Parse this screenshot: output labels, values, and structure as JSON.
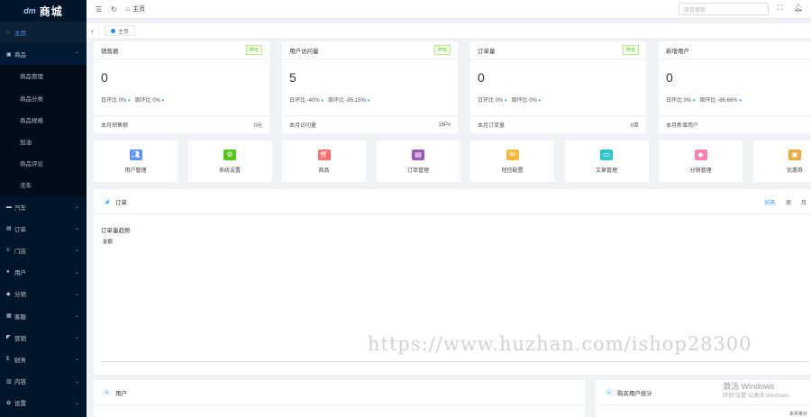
{
  "brand": {
    "mark": "dm",
    "name": "商城"
  },
  "sidebar": {
    "home": {
      "icon": "⌂",
      "label": "主页"
    },
    "goods_group": {
      "icon": "▣",
      "label": "商品"
    },
    "goods_sub": [
      "商品管理",
      "商品分类",
      "商品规格",
      "加油",
      "商品评论",
      "洗车"
    ],
    "groups": [
      {
        "icon": "▬",
        "label": "汽车"
      },
      {
        "icon": "▤",
        "label": "订单"
      },
      {
        "icon": "≡",
        "label": "门店"
      },
      {
        "icon": "●",
        "label": "用户"
      },
      {
        "icon": "◆",
        "label": "分销"
      },
      {
        "icon": "▦",
        "label": "客服"
      },
      {
        "icon": "◤",
        "label": "营销"
      },
      {
        "icon": "$",
        "label": "财务"
      },
      {
        "icon": "▥",
        "label": "内容"
      },
      {
        "icon": "✿",
        "label": "设置"
      }
    ]
  },
  "header": {
    "home_label": "主页",
    "search_placeholder": "菜单搜索"
  },
  "tabs": {
    "active": "主页"
  },
  "stats": [
    {
      "title": "销售额",
      "badge": "昨日",
      "value": "0",
      "day_ratio": "日环比 0%",
      "week_ratio": "周环比 0%",
      "foot_label": "本月销售额",
      "foot_value": "0元"
    },
    {
      "title": "用户访问量",
      "badge": "昨日",
      "value": "5",
      "day_ratio": "日环比 -40%",
      "week_ratio": "周环比 -85.15%",
      "foot_label": "本月访问量",
      "foot_value": "16Pv"
    },
    {
      "title": "订单量",
      "badge": "昨日",
      "value": "0",
      "day_ratio": "日环比 0%",
      "week_ratio": "周环比 0%",
      "foot_label": "本月订单量",
      "foot_value": "0单"
    },
    {
      "title": "新增用户",
      "badge": "昨日",
      "value": "0",
      "day_ratio": "日环比 0%",
      "week_ratio": "周环比 -66.66%",
      "foot_label": "本月新增用户",
      "foot_value": ""
    }
  ],
  "quick_links": [
    {
      "icon": "users-icon",
      "label": "用户管理",
      "color": "#5b8ff9"
    },
    {
      "icon": "gear-icon",
      "label": "系统设置",
      "color": "#52c41a"
    },
    {
      "icon": "cart-icon",
      "label": "商品",
      "color": "#ff6b6b"
    },
    {
      "icon": "clipboard-icon",
      "label": "订单管理",
      "color": "#9b59b6"
    },
    {
      "icon": "mail-icon",
      "label": "短信配置",
      "color": "#f5b93b"
    },
    {
      "icon": "card-icon",
      "label": "文章管理",
      "color": "#2ec7c9"
    },
    {
      "icon": "tag-icon",
      "label": "分销管理",
      "color": "#ff7eb3"
    },
    {
      "icon": "coupon-icon",
      "label": "优惠券",
      "color": "#f0a93b"
    }
  ],
  "orders_panel": {
    "title": "订单",
    "ranges": [
      "30天",
      "周",
      "月"
    ],
    "trend_title": "订单量趋势",
    "trend_sub": "金额"
  },
  "users_panel": {
    "title": "用户"
  },
  "buyers_panel": {
    "title": "购买用户统计"
  },
  "watermark": "https://www.huzhan.com/ishop28300",
  "activation": {
    "title": "激活 Windows",
    "sub": "转到\"设置\"以激活 Windows。"
  },
  "corner_text": "本月累计"
}
